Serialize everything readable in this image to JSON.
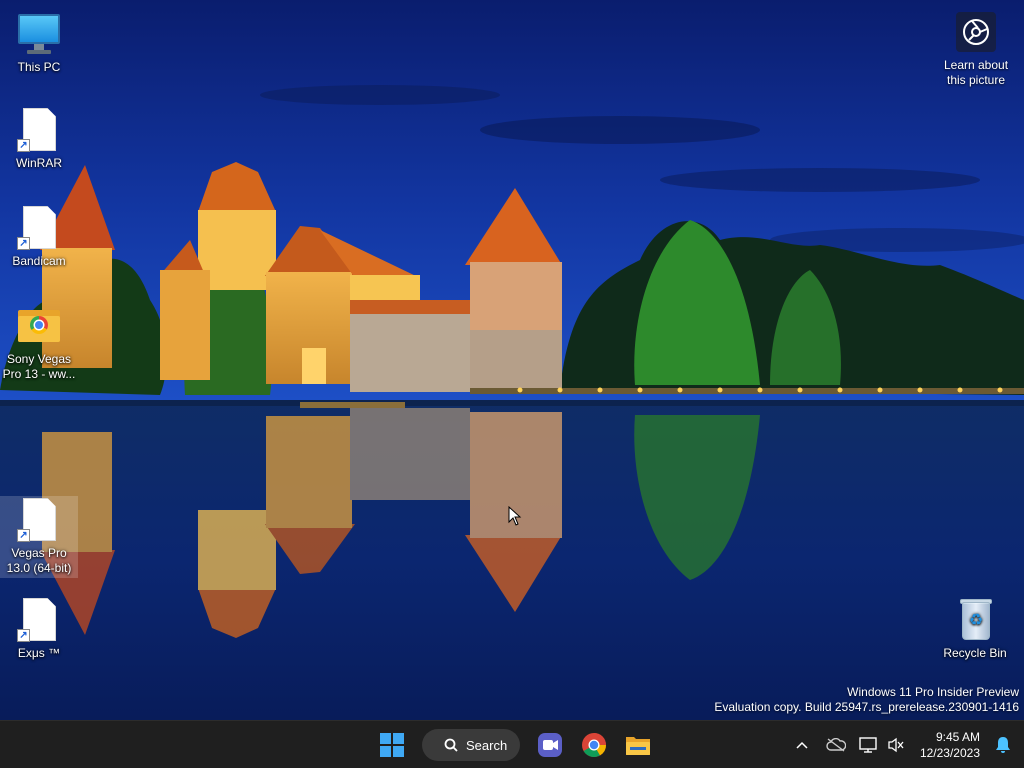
{
  "desktop": {
    "icons": [
      {
        "label": "This PC",
        "icon": "this-pc-icon"
      },
      {
        "label": "WinRAR",
        "icon": "file-shortcut-icon"
      },
      {
        "label": "Bandicam",
        "icon": "file-shortcut-icon"
      },
      {
        "label": "Sony Vegas Pro 13 - ww...",
        "icon": "chrome-folder-icon"
      },
      {
        "label": "Vegas Pro 13.0 (64-bit)",
        "icon": "file-shortcut-icon"
      },
      {
        "label": "Exμs ™",
        "icon": "file-shortcut-icon"
      },
      {
        "label": "Recycle Bin",
        "icon": "recycle-bin-icon"
      }
    ],
    "learn_about": {
      "label": "Learn about this picture",
      "icon": "camera-icon"
    },
    "watermark": {
      "line1": "Windows 11 Pro Insider Preview",
      "line2": "Evaluation copy. Build 25947.rs_prerelease.230901-1416"
    }
  },
  "taskbar": {
    "search_label": "Search",
    "apps": [
      "start-icon",
      "search-icon",
      "meet-icon",
      "chrome-icon",
      "file-explorer-icon"
    ],
    "tray": {
      "icons": [
        "chevron-up-icon",
        "onedrive-offline-icon",
        "network-icon",
        "volume-muted-icon",
        "notification-bell-icon"
      ],
      "time": "9:45 AM",
      "date": "12/23/2023"
    }
  },
  "colors": {
    "taskbar_bg": "#1f1f1f",
    "start_blue": "#3fa9f5",
    "sky_top": "#0b1f6a"
  }
}
